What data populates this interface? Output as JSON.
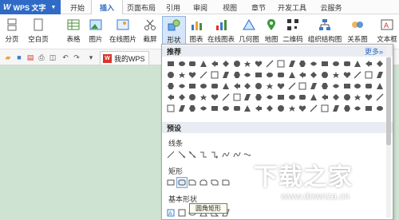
{
  "app": {
    "title": "WPS 文字"
  },
  "tabs": [
    "开始",
    "插入",
    "页面布局",
    "引用",
    "审阅",
    "视图",
    "章节",
    "开发工具",
    "云服务"
  ],
  "active_tab": "插入",
  "ribbon": {
    "page_break": "分页",
    "blank_page": "空白页",
    "table": "表格",
    "picture": "图片",
    "online_picture": "在线图片",
    "screenshot": "截屏",
    "shapes": "形状",
    "chart": "图表",
    "online_chart": "在线图表",
    "geometry": "几何图",
    "map": "地图",
    "qrcode": "二维码",
    "org_chart": "组织结构图",
    "relation": "关系图",
    "textbox": "文本框"
  },
  "quickbar": {
    "doc_tab": "我的WPS"
  },
  "panel": {
    "recommended": "推荐",
    "more": "更多»",
    "presets": "预设",
    "lines": "线条",
    "rectangles": "矩形",
    "basic_shapes": "基本形状",
    "tooltip": "圆角矩形"
  },
  "watermark": {
    "title": "下载之家",
    "url": "www.downza.cn"
  },
  "colors": {
    "accent": "#2f6bc6",
    "workspace": "#cfe3d2"
  }
}
